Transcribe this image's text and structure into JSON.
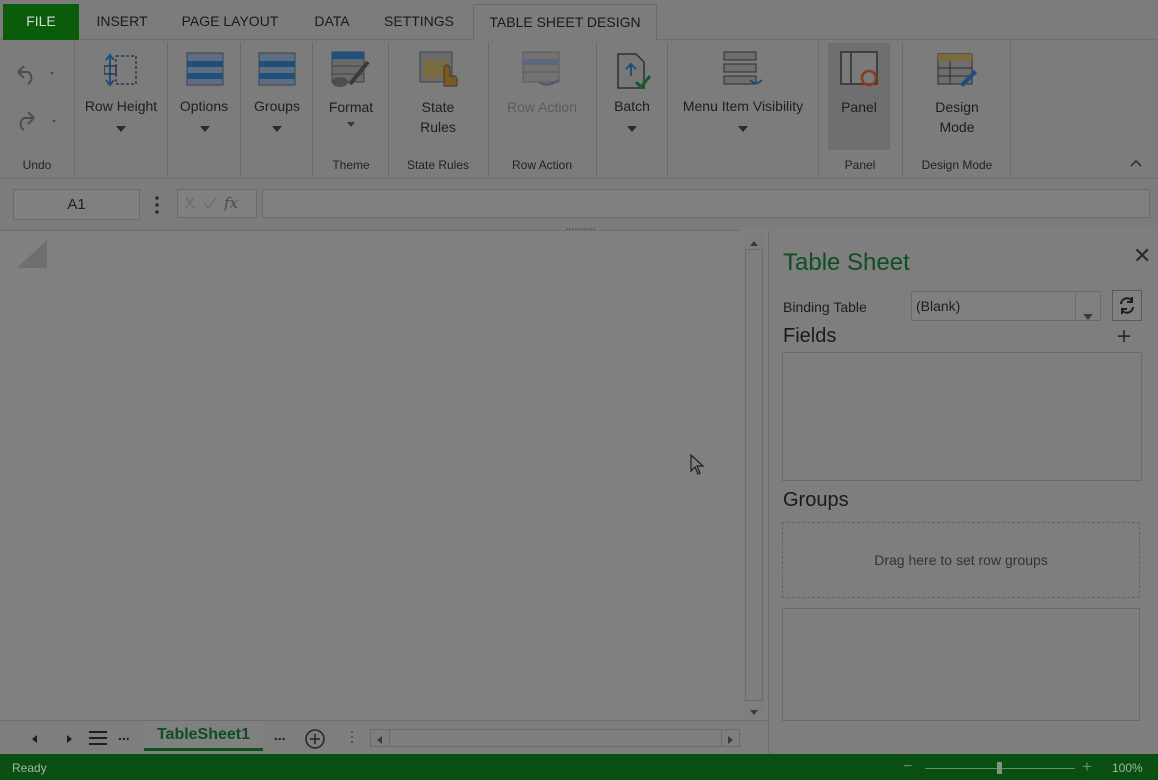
{
  "tabs": {
    "file": "FILE",
    "insert": "INSERT",
    "page_layout": "PAGE LAYOUT",
    "data": "DATA",
    "settings": "SETTINGS",
    "table_sheet_design": "TABLE SHEET DESIGN"
  },
  "ribbon": {
    "row_height": "Row Height",
    "options": "Options",
    "groups": "Groups",
    "format": "Format",
    "state_rules_1": "State",
    "state_rules_2": "Rules",
    "row_action": "Row Action",
    "batch": "Batch",
    "menu_item_visibility": "Menu Item Visibility",
    "panel": "Panel",
    "design_mode_1": "Design",
    "design_mode_2": "Mode",
    "group_labels": {
      "undo": "Undo",
      "theme": "Theme",
      "state_rules": "State Rules",
      "row_action": "Row Action",
      "panel": "Panel",
      "design_mode": "Design Mode"
    }
  },
  "formula_bar": {
    "name_box": "A1",
    "fx": "fx"
  },
  "panel": {
    "title": "Table Sheet",
    "binding_label": "Binding Table",
    "binding_value": "(Blank)",
    "fields_title": "Fields",
    "groups_title": "Groups",
    "groups_placeholder": "Drag here to set row groups"
  },
  "sheet_tabs": {
    "active_sheet": "TableSheet1",
    "more": "..."
  },
  "status": {
    "text": "Ready",
    "zoom": "100%"
  },
  "icons": [
    "undo-icon",
    "redo-icon",
    "row-height-icon",
    "options-icon",
    "groups-icon",
    "format-icon",
    "state-rules-icon",
    "row-action-icon",
    "batch-icon",
    "menu-visibility-icon",
    "panel-icon",
    "design-mode-icon",
    "close-icon",
    "refresh-icon",
    "plus-icon",
    "cursor-icon"
  ]
}
